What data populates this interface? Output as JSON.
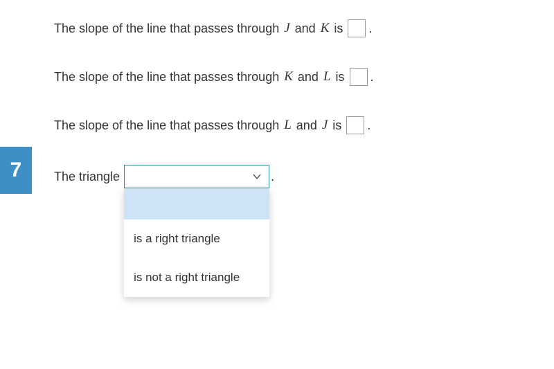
{
  "badge": {
    "number": "7"
  },
  "lines": [
    {
      "pre": "The slope of the line that passes through ",
      "p1": "J",
      "mid": " and ",
      "p2": "K",
      "post": " is ",
      "end": "."
    },
    {
      "pre": "The slope of the line that passes through ",
      "p1": "K",
      "mid": " and ",
      "p2": "L",
      "post": " is ",
      "end": "."
    },
    {
      "pre": "The slope of the line that passes through ",
      "p1": "L",
      "mid": " and ",
      "p2": "J",
      "post": " is ",
      "end": "."
    }
  ],
  "triangle_row": {
    "label": "The triangle ",
    "after": "."
  },
  "dropdown": {
    "value": "",
    "options": [
      "",
      "is a right triangle",
      "is not a right triangle"
    ],
    "highlight_index": 0
  }
}
